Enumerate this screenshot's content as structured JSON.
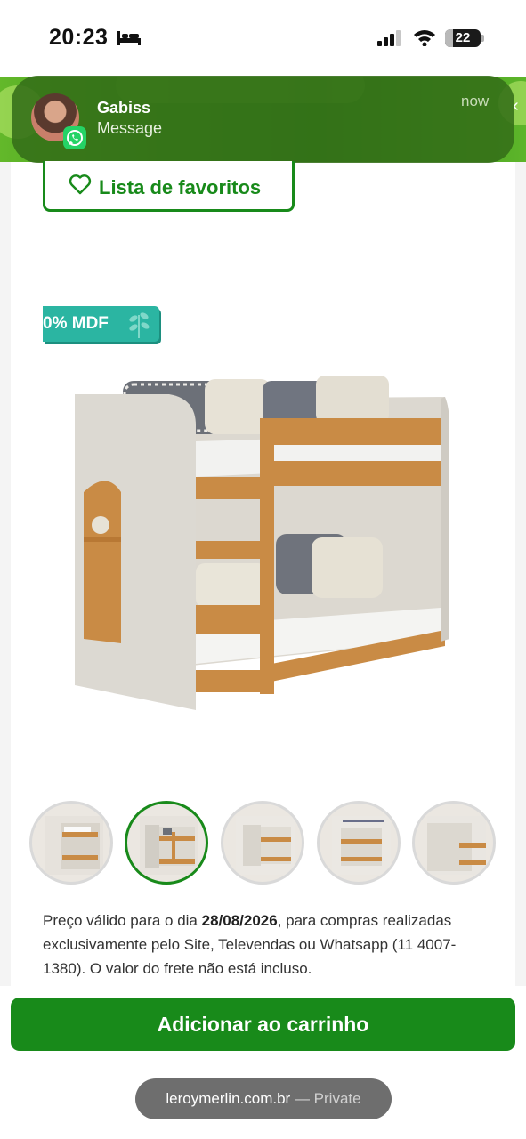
{
  "status_bar": {
    "time": "20:23",
    "battery": "22",
    "icons": [
      "bed-icon",
      "cellular-signal-icon",
      "wifi-icon",
      "battery-icon"
    ]
  },
  "notification": {
    "sender": "Gabiss",
    "body": "Message",
    "time": "now",
    "app_icon": "whatsapp-icon"
  },
  "product": {
    "favorites_label": "Lista de favoritos",
    "badge_text": "0% MDF",
    "image": "bunk-bed-photo",
    "thumbnails_count": 5,
    "active_thumbnail": 2,
    "price_note_prefix": "Preço válido para o dia ",
    "price_note_date": "28/08/2026",
    "price_note_suffix": ", para compras realizadas exclusivamente pelo Site, Televendas ou Whatsapp (11 4007-1380). O valor do frete não está incluso.",
    "add_to_cart_label": "Adicionar ao carrinho"
  },
  "browser": {
    "domain": "leroymerlin.com.br",
    "separator": " — ",
    "mode": "Private"
  },
  "colors": {
    "brand_green": "#188a1a",
    "badge_teal": "#2bb5a2",
    "notification_bg": "#346e18"
  }
}
